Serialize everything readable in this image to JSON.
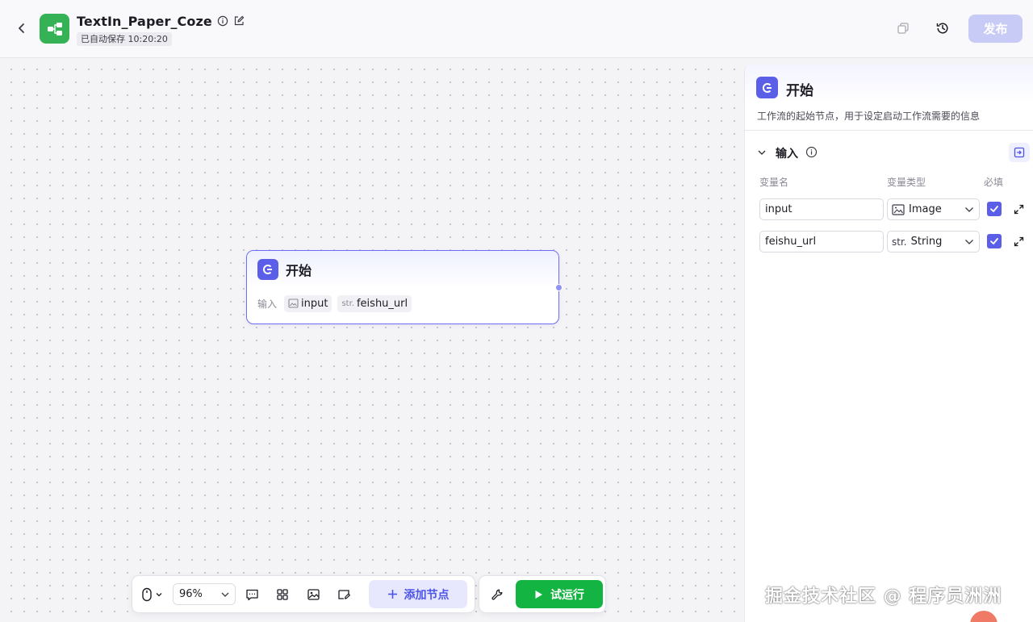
{
  "header": {
    "title": "TextIn_Paper_Coze",
    "autosave": "已自动保存 10:20:20",
    "publish_label": "发布"
  },
  "node": {
    "title": "开始",
    "input_label": "输入",
    "chips": [
      {
        "type_label": "",
        "name": "input",
        "icon": "image-icon"
      },
      {
        "type_label": "str.",
        "name": "feishu_url",
        "icon": ""
      }
    ]
  },
  "toolbar": {
    "zoom": "96%",
    "add_node_label": "添加节点",
    "run_label": "试运行"
  },
  "panel": {
    "title": "开始",
    "description": "工作流的起始节点，用于设定启动工作流需要的信息",
    "section_title": "输入",
    "columns": {
      "name": "变量名",
      "type": "变量类型",
      "required": "必填"
    },
    "rows": [
      {
        "name": "input",
        "type_prefix": "",
        "type": "Image",
        "required": true
      },
      {
        "name": "feishu_url",
        "type_prefix": "str.",
        "type": "String",
        "required": true
      }
    ]
  },
  "watermark": "掘金技术社区 @ 程序员洲洲",
  "colors": {
    "accent": "#5b5fe8",
    "run_green": "#14b442",
    "logo_green": "#35b255",
    "publish_disabled": "#c9cbf7"
  }
}
